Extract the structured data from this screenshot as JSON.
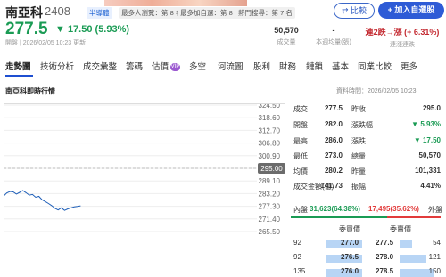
{
  "header": {
    "name": "南亞科",
    "code": "2408",
    "tags": [
      "半導體",
      "最多人瀏覽：第 8 名",
      "最多加自選：第 8 名",
      "熱門搜尋：第 7 名"
    ],
    "compare_label": "比較",
    "add_watchlist_label": "加入自選股"
  },
  "quote": {
    "price": "277.5",
    "change": "▼ 17.50 (5.93%)",
    "timestamp": "開盤 | 2026/02/05 10:23 更新",
    "volume": "50,570",
    "volume_label": "成交量",
    "avg_volume": "-",
    "avg_volume_label": "本週均量(張)",
    "limit": "連2跌→漲 (+ 6.31%)",
    "limit_label": "連漲連跌"
  },
  "tabs": [
    "走勢圖",
    "技術分析",
    "成交彙整",
    "籌碼",
    "估價",
    "多空",
    "河流圖",
    "股利",
    "財務",
    "鏈鎖",
    "基本",
    "同業比較",
    "更多..."
  ],
  "vip_label": "VIP",
  "panel": {
    "title": "南亞科即時行情",
    "data_time": "資料時間：2026/02/05 10:23"
  },
  "chart_data": {
    "type": "line",
    "y_ticks": [
      "324.50",
      "318.60",
      "312.70",
      "306.80",
      "300.90",
      "295.00",
      "289.10",
      "283.20",
      "277.30",
      "271.40",
      "265.50"
    ],
    "ylim": [
      265.5,
      324.5
    ],
    "reference": "295.00",
    "series": [
      {
        "values": [
          282.0,
          283.5,
          284.2,
          284.0,
          283.0,
          283.8,
          284.6,
          283.6,
          282.5,
          282.8,
          281.5,
          281.9,
          280.3,
          279.5,
          278.6,
          277.6,
          276.4,
          275.6,
          276.6,
          275.4,
          276.1,
          276.6,
          277.0,
          277.2,
          277.5
        ]
      }
    ]
  },
  "info": [
    {
      "k1": "成交",
      "v1": "277.5",
      "k2": "昨收",
      "v2": "295.0"
    },
    {
      "k1": "開盤",
      "v1": "282.0",
      "k2": "漲跌幅",
      "v2": "▼ 5.93%"
    },
    {
      "k1": "最高",
      "v1": "286.0",
      "k2": "漲跌",
      "v2": "▼ 17.50"
    },
    {
      "k1": "最低",
      "v1": "273.0",
      "k2": "總量",
      "v2": "50,570"
    },
    {
      "k1": "均價",
      "v1": "280.2",
      "k2": "昨量",
      "v2": "101,331"
    },
    {
      "k1": "成交金額(億)",
      "v1": "141.73",
      "k2": "振幅",
      "v2": "4.41%"
    }
  ],
  "buysell": {
    "inner_label": "內盤",
    "inner_value": "31,623(64.38%)",
    "outer_value": "17,495(35.62%)",
    "outer_label": "外盤",
    "inner_ratio": 0.6438
  },
  "orderbook": {
    "buy_header": "委買價",
    "sell_header": "委賣價",
    "rows": [
      {
        "bq": "92",
        "bp": "277.0",
        "sp": "277.5",
        "sq": "54"
      },
      {
        "bq": "92",
        "bp": "276.5",
        "sp": "278.0",
        "sq": "121"
      },
      {
        "bq": "135",
        "bp": "276.0",
        "sp": "278.5",
        "sq": "150"
      }
    ]
  }
}
